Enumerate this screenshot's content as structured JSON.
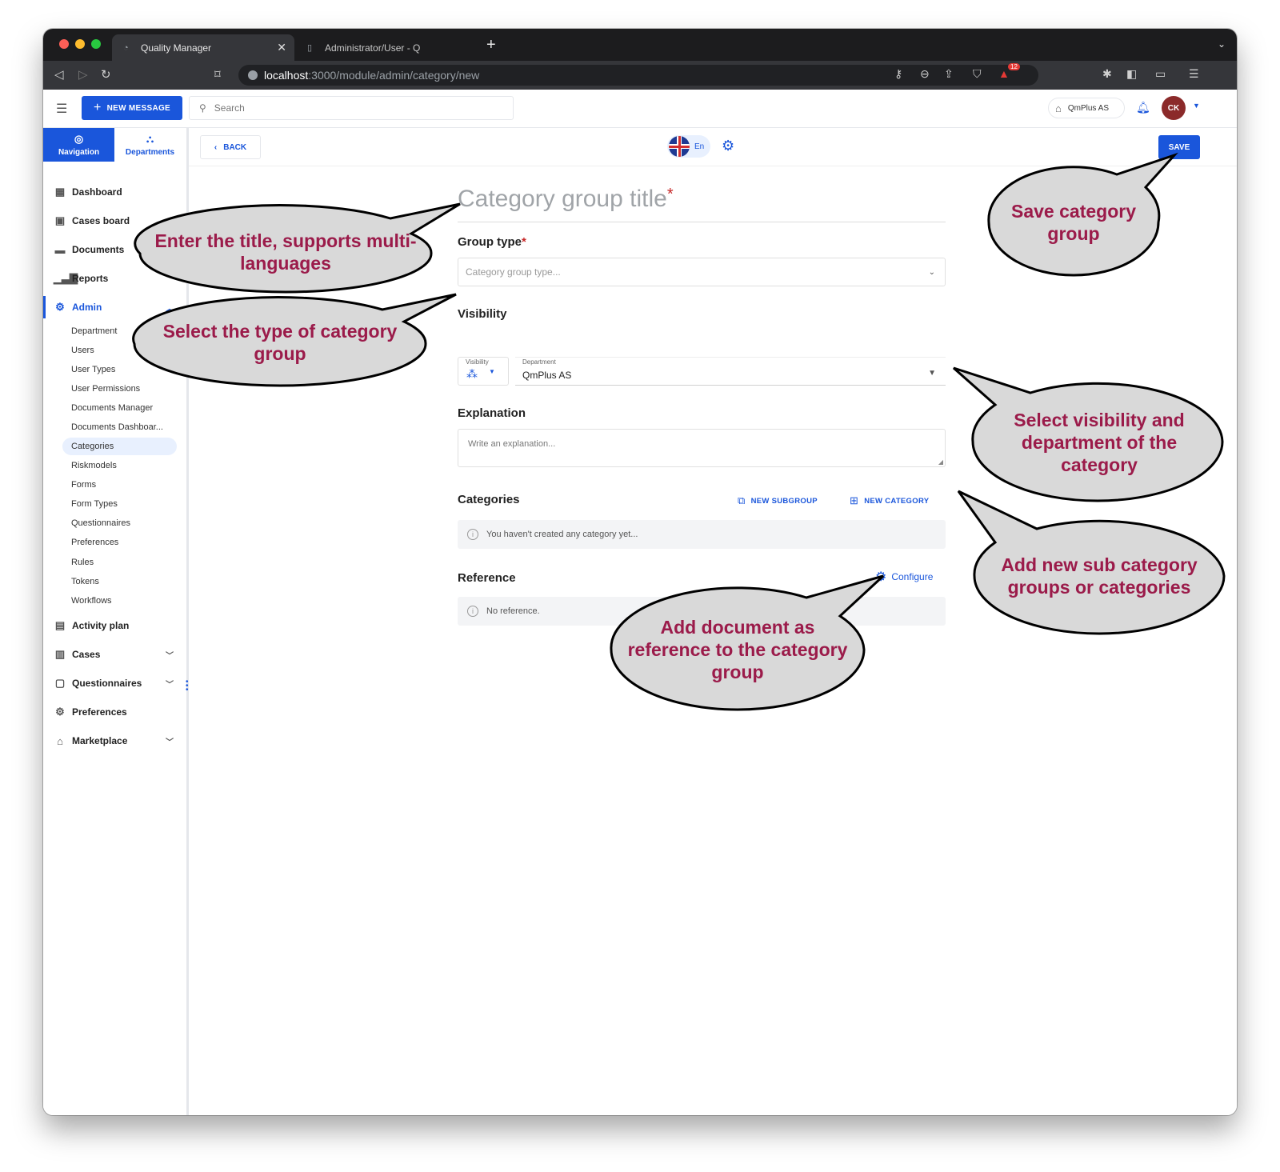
{
  "browser": {
    "tabs": [
      {
        "title": "Quality Manager",
        "active": true
      },
      {
        "title": "Administrator/User - Q",
        "active": false
      }
    ],
    "url_host": "localhost",
    "url_path": ":3000/module/admin/category/new",
    "shield_badge": "12"
  },
  "header": {
    "new_message_label": "NEW MESSAGE",
    "search_placeholder": "Search",
    "org_name": "QmPlus AS",
    "avatar_initials": "CK"
  },
  "sidebar": {
    "tabs": [
      {
        "label": "Navigation",
        "icon": "compass-icon"
      },
      {
        "label": "Departments",
        "icon": "org-chart-icon"
      }
    ],
    "items": [
      {
        "label": "Dashboard",
        "icon": "grid-icon"
      },
      {
        "label": "Cases board",
        "icon": "board-icon"
      },
      {
        "label": "Documents",
        "icon": "folder-icon"
      },
      {
        "label": "Reports",
        "icon": "bar-chart-icon"
      },
      {
        "label": "Admin",
        "icon": "users-cog-icon"
      }
    ],
    "admin_subitems": [
      "Department",
      "Users",
      "User Types",
      "User Permissions",
      "Documents Manager",
      "Documents Dashboar...",
      "Categories",
      "Riskmodels",
      "Forms",
      "Form Types",
      "Questionnaires",
      "Preferences",
      "Rules",
      "Tokens",
      "Workflows"
    ],
    "active_subitem": "Categories",
    "items_after": [
      {
        "label": "Activity plan",
        "icon": "calendar-icon"
      },
      {
        "label": "Cases",
        "icon": "cases-icon"
      },
      {
        "label": "Questionnaires",
        "icon": "clipboard-icon"
      },
      {
        "label": "Preferences",
        "icon": "gear-icon"
      },
      {
        "label": "Marketplace",
        "icon": "store-icon"
      }
    ]
  },
  "toolbar": {
    "back_label": "BACK",
    "language_label": "En",
    "save_label": "SAVE"
  },
  "form": {
    "title_placeholder": "Category group title",
    "required_mark": "*",
    "group_type_label": "Group type",
    "group_type_placeholder": "Category group type...",
    "visibility_label": "Visibility",
    "visibility_mini_label": "Visibility",
    "department_mini_label": "Department",
    "department_value": "QmPlus AS",
    "explanation_label": "Explanation",
    "explanation_placeholder": "Write an explanation...",
    "categories_label": "Categories",
    "new_subgroup_label": "NEW SUBGROUP",
    "new_category_label": "NEW CATEGORY",
    "categories_empty": "You haven't created any category yet...",
    "reference_label": "Reference",
    "configure_label": "Configure",
    "reference_empty": "No reference."
  },
  "callouts": {
    "title": "Enter the title, supports multi-languages",
    "group_type": "Select the type of category group",
    "save": "Save category group",
    "visibility": "Select visibility and department of the category",
    "new_items": "Add new sub category groups or categories",
    "reference": "Add document as reference to the category group"
  },
  "colors": {
    "primary": "#1a56db",
    "callout_text": "#9b1b4a",
    "callout_fill": "#d9d9d9"
  }
}
